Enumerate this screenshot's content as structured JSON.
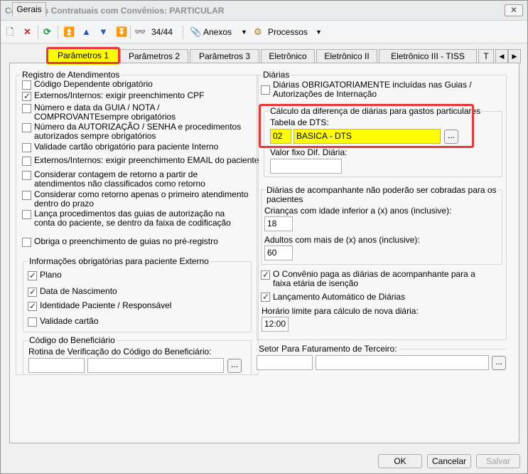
{
  "window": {
    "title": "Condições Contratuais com Convênios: PARTICULAR",
    "close": "✕"
  },
  "toolbar": {
    "record_counter": "34/44",
    "anexos": "Anexos",
    "processos": "Processos"
  },
  "tabs": [
    "Gerais",
    "Parâmetros 1",
    "Parâmetros 2",
    "Parâmetros 3",
    "Eletrônico",
    "Eletrônico II",
    "Eletrônico III - TISS",
    "T"
  ],
  "registro": {
    "title": "Registro de Atendimentos",
    "items": [
      {
        "label": "Código Dependente obrigatório",
        "checked": false
      },
      {
        "label": "Externos/Internos: exigir preenchimento CPF",
        "checked": true
      },
      {
        "label": "Número e data da GUIA / NOTA /\nCOMPROVANTEsempre obrigatórios",
        "checked": false
      },
      {
        "label": "Número da AUTORIZAÇÃO / SENHA e procedimentos\nautorizados sempre obrigatórios",
        "checked": false
      },
      {
        "label": "Validade cartão obrigatório para paciente Interno",
        "checked": false
      },
      {
        "label": "Externos/Internos: exigir preenchimento EMAIL do paciente",
        "checked": false
      },
      {
        "label": "Considerar contagem de retorno a partir de\natendimentos não classificados como retorno",
        "checked": false
      },
      {
        "label": "Considerar como retorno apenas o primeiro atendimento\ndentro do prazo",
        "checked": false
      },
      {
        "label": "Lança procedimentos das guias de autorização na\nconta do paciente, se dentro da faixa de codificação",
        "checked": false
      },
      {
        "label": "Obriga o preenchimento de guias no pré-registro",
        "checked": false
      }
    ]
  },
  "externo": {
    "title": "Informações obrigatórias para paciente Externo",
    "items": [
      {
        "label": "Plano",
        "checked": true
      },
      {
        "label": "Data de Nascimento",
        "checked": true
      },
      {
        "label": "Identidade Paciente / Responsável",
        "checked": true
      },
      {
        "label": "Validade cartão",
        "checked": false
      }
    ]
  },
  "beneficiario": {
    "title": "Código do Beneficiário",
    "rotina_label": "Rotina de Verificação do Código do Beneficiário:",
    "code": "",
    "desc": ""
  },
  "diarias": {
    "title": "Diárias",
    "obrig_label": "Diárias OBRIGATORIAMENTE incluídas nas Guias /\nAutorizações de Internação",
    "obrig_checked": false,
    "calc_title": "Cálculo da diferença de diárias para gastos particulares",
    "tabela_label": "Tabela de DTS:",
    "tabela_code": "02",
    "tabela_desc": "BASICA - DTS",
    "valor_fixo_label": "Valor fixo Dif. Diária:",
    "valor_fixo": "",
    "acomp_title": "Diárias de acompanhante não poderão ser cobradas para os\npacientes",
    "criancas_label": "Crianças com idade inferior a (x) anos (inclusive):",
    "criancas_value": "18",
    "adultos_label": "Adultos com mais de (x) anos (inclusive):",
    "adultos_value": "60",
    "convenio_paga_label": "O Convênio paga as diárias de acompanhante para a\nfaixa etária de isenção",
    "convenio_paga_checked": true,
    "lanc_auto_label": "Lançamento Automático de Diárias",
    "lanc_auto_checked": true,
    "horario_label": "Horário limite para cálculo de nova diária:",
    "horario_value": "12:00"
  },
  "terceiro": {
    "label": "Setor Para Faturamento de Terceiro:",
    "code": "",
    "desc": ""
  },
  "buttons": {
    "ok": "OK",
    "cancel": "Cancelar",
    "save": "Salvar"
  },
  "colors": {
    "highlight_yellow": "#ffff00",
    "annotation_red": "#e8383c"
  }
}
